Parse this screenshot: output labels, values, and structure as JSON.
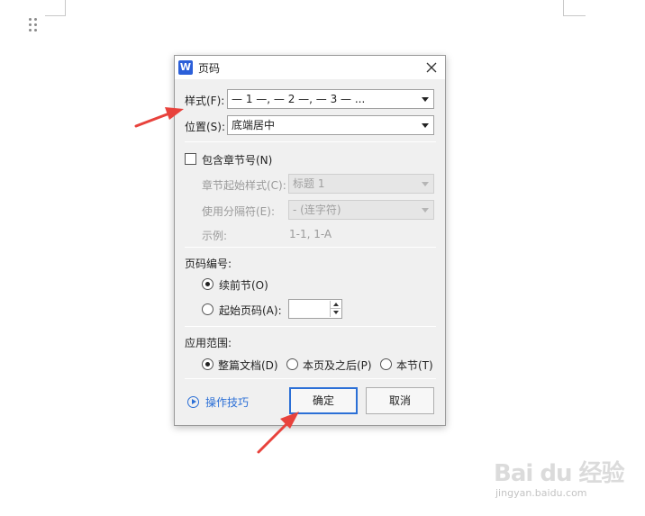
{
  "dialog": {
    "app_icon_letter": "W",
    "title": "页码",
    "style_label": "样式(F):",
    "style_value": "— 1 —, — 2 —, — 3 — ...",
    "position_label": "位置(S):",
    "position_value": "底端居中",
    "include_chapter_label": "包含章节号(N)",
    "chapter_style_label": "章节起始样式(C):",
    "chapter_style_value": "标题 1",
    "separator_label": "使用分隔符(E):",
    "separator_value": "-    (连字符)",
    "example_label": "示例:",
    "example_value": "1-1, 1-A",
    "numbering_header": "页码编号:",
    "continue_label": "续前节(O)",
    "start_at_label": "起始页码(A):",
    "start_at_value": "",
    "apply_header": "应用范围:",
    "apply_whole_label": "整篇文档(D)",
    "apply_after_label": "本页及之后(P)",
    "apply_section_label": "本节(T)",
    "tips_label": "操作技巧",
    "ok_label": "确定",
    "cancel_label": "取消"
  },
  "watermark": {
    "logo_text": "Bai du 经验",
    "url_text": "jingyan.baidu.com"
  },
  "colors": {
    "accent": "#2b6fd6",
    "annotation_arrow": "#e8423c",
    "app_icon": "#2b5fd9"
  }
}
